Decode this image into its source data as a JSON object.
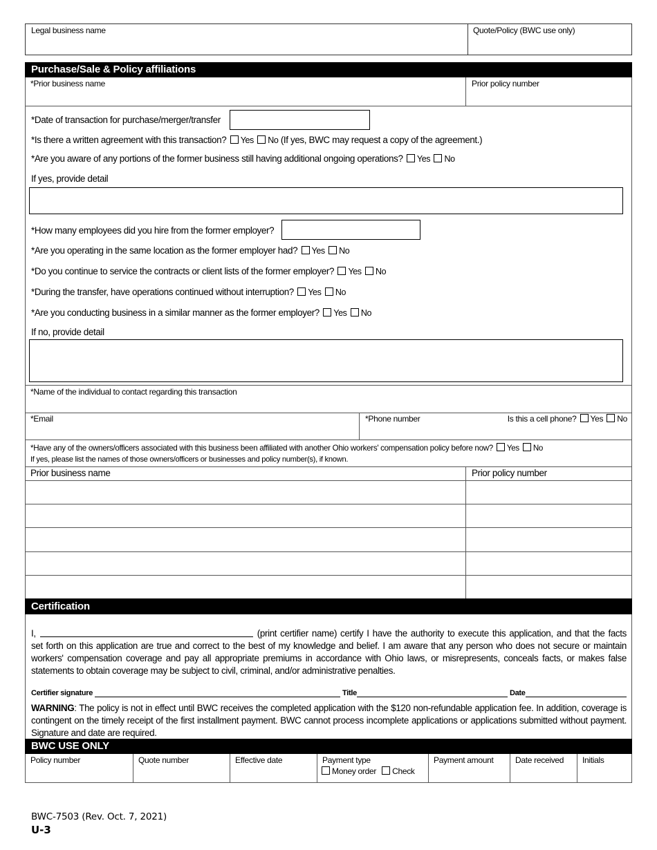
{
  "header": {
    "legal_business_name_label": "Legal business name",
    "quote_policy_label": "Quote/Policy (BWC use only)"
  },
  "purchase_section": {
    "title": "Purchase/Sale & Policy affiliations",
    "prior_business_name_label": "*Prior business name",
    "prior_policy_number_label": "Prior policy number",
    "date_of_transaction_label": "*Date of transaction for purchase/merger/transfer",
    "written_agreement_question": "*Is there a written agreement with this transaction?",
    "written_agreement_note": "(If yes, BWC may request a copy of the agreement.)",
    "ongoing_operations_question": "*Are you aware of any portions of the former business still having additional ongoing operations?",
    "if_yes_detail_label": "If yes, provide detail",
    "employees_hired_question": "*How many employees did you hire from the former employer?",
    "same_location_question": "*Are you operating in the same location as the former employer had?",
    "service_contracts_question": "*Do you continue to service the contracts or client lists of the former employer?",
    "operations_continued_question": "*During the transfer, have operations continued without interruption?",
    "similar_manner_question": "*Are you conducting business in a similar manner as the former employer?",
    "if_no_detail_label": "If no, provide detail",
    "contact_name_label": "*Name of the individual to contact regarding this transaction",
    "email_label": "*Email",
    "phone_label": "*Phone number",
    "cell_phone_question": "Is this a cell phone?",
    "affiliated_question": "*Have any of the owners/officers associated with this business been affiliated with another Ohio workers' compensation policy before now?",
    "affiliated_note": "If yes, please list the names of those owners/officers or businesses and policy number(s), if known.",
    "yes_label": "Yes",
    "no_label": "No"
  },
  "affiliations_table": {
    "columns": [
      "Prior business name",
      "Prior policy number"
    ],
    "rows": [
      [
        "",
        ""
      ],
      [
        "",
        ""
      ],
      [
        "",
        ""
      ],
      [
        "",
        ""
      ],
      [
        "",
        ""
      ]
    ]
  },
  "certification": {
    "title": "Certification",
    "prefix": "I,",
    "paragraph_first_line_rest": "(print certifier name) certify I have the authority to execute this application, and that the facts",
    "paragraph_rest": "set forth on this application are true and correct to the best of my knowledge and belief. I am aware that any person who does not secure or maintain workers' compensation coverage and pay all appropriate premiums in accordance with Ohio laws, or misrepresents, conceals facts, or makes false statements to obtain coverage may be subject to civil, criminal, and/or administrative penalties.",
    "signature_label": "Certifier signature",
    "title_label": "Title",
    "date_label": "Date",
    "warning_label": "WARNING",
    "warning_text": ": The policy is not in effect until BWC receives the completed application with the $120 non-refundable application fee. In addition, coverage is contingent on the timely receipt of the first installment payment. BWC cannot process incomplete applications or applications submitted without payment. Signature and date are required."
  },
  "bwc_use_only": {
    "title": "BWC USE ONLY",
    "columns": [
      "Policy number",
      "Quote number",
      "Effective date",
      "Payment type",
      "Payment amount",
      "Date received",
      "Initials"
    ],
    "payment_options": [
      "Money order",
      "Check"
    ]
  },
  "footer": {
    "form_id": "BWC-7503 (Rev. Oct. 7, 2021)",
    "page_code": "U-3"
  }
}
